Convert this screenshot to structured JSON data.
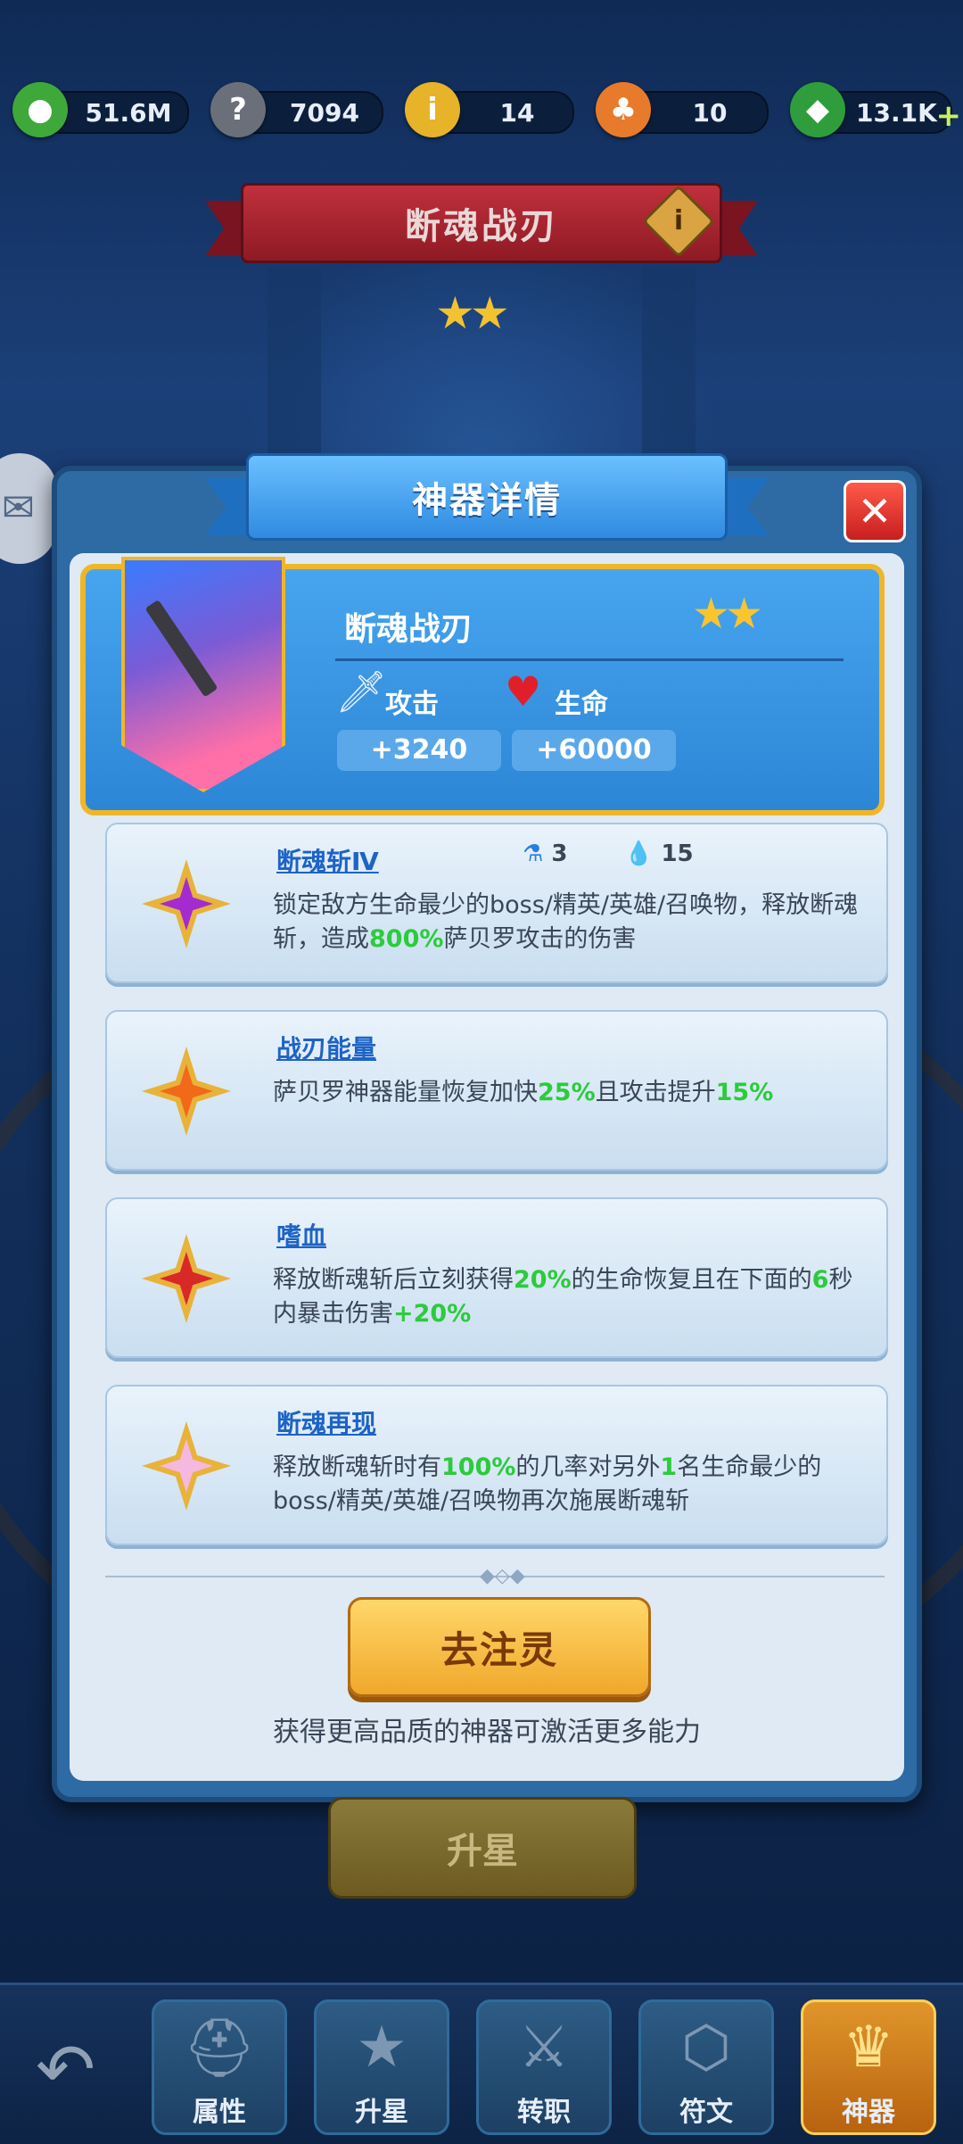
{
  "resources": [
    {
      "icon": "green-orb-icon",
      "value": "51.6M",
      "color": "#3fa83a"
    },
    {
      "icon": "stone-key-icon",
      "value": "7094",
      "color": "#6a6f7a"
    },
    {
      "icon": "gold-card-icon",
      "value": "14",
      "color": "#e6b329"
    },
    {
      "icon": "fire-badge-icon",
      "value": "10",
      "color": "#e87a2c"
    },
    {
      "icon": "green-gem-icon",
      "value": "13.1K",
      "color": "#2f9d3c"
    }
  ],
  "banner": {
    "title": "断魂战刃",
    "stars": "★★"
  },
  "dialog": {
    "title": "神器详情",
    "close": "✕",
    "item": {
      "name": "断魂战刃",
      "stars": "★★",
      "attack_label": "攻击",
      "attack_value": "+3240",
      "hp_label": "生命",
      "hp_value": "+60000"
    },
    "skills": [
      {
        "title": "断魂斩Ⅳ",
        "cost1": "3",
        "cost2": "15",
        "desc": [
          [
            "锁定敌方生命最少的boss/精英/英雄/召唤物，释放断魂斩，造成",
            false
          ],
          [
            "800%",
            true
          ],
          [
            "萨贝罗攻击的伤害",
            false
          ]
        ],
        "color": "#a42bd0"
      },
      {
        "title": "战刃能量",
        "desc": [
          [
            "萨贝罗神器能量恢复加快",
            false
          ],
          [
            "25%",
            true
          ],
          [
            "且攻击提升",
            false
          ],
          [
            "15%",
            true
          ]
        ],
        "color": "#f06a1a"
      },
      {
        "title": "嗜血",
        "desc": [
          [
            "释放断魂斩后立刻获得",
            false
          ],
          [
            "20%",
            true
          ],
          [
            "的生命恢复且在下面的",
            false
          ],
          [
            "6",
            true
          ],
          [
            "秒内暴击伤害",
            false
          ],
          [
            "+20%",
            true
          ]
        ],
        "color": "#d82828"
      },
      {
        "title": "断魂再现",
        "desc": [
          [
            "释放断魂斩时有",
            false
          ],
          [
            "100%",
            true
          ],
          [
            "的几率对另外",
            false
          ],
          [
            "1",
            true
          ],
          [
            "名生命最少的boss/精英/英雄/召唤物再次施展断魂斩",
            false
          ]
        ],
        "color": "#f5b8e0"
      }
    ],
    "action_button": "去注灵",
    "hint": "获得更高品质的神器可激活更多能力"
  },
  "upstar_button": "升星",
  "nav": {
    "back": "↶",
    "tabs": [
      {
        "label": "属性",
        "glyph": "⛑",
        "active": false
      },
      {
        "label": "升星",
        "glyph": "★",
        "active": false
      },
      {
        "label": "转职",
        "glyph": "⚔",
        "active": false
      },
      {
        "label": "符文",
        "glyph": "⬡",
        "active": false
      },
      {
        "label": "神器",
        "glyph": "♛",
        "active": true
      }
    ]
  }
}
